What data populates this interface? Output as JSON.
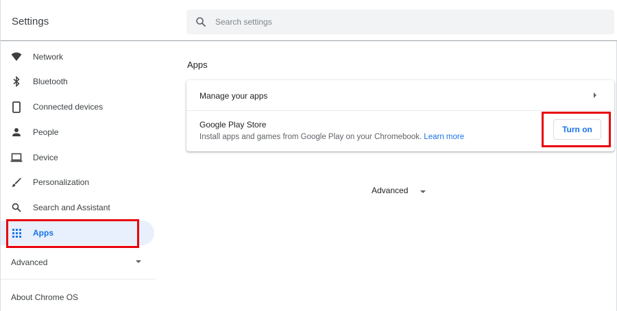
{
  "header": {
    "title": "Settings",
    "search_placeholder": "Search settings",
    "search_value": ""
  },
  "sidebar": {
    "items": [
      {
        "label": "Network",
        "icon": "wifi-icon"
      },
      {
        "label": "Bluetooth",
        "icon": "bluetooth-icon"
      },
      {
        "label": "Connected devices",
        "icon": "phone-icon"
      },
      {
        "label": "People",
        "icon": "person-icon"
      },
      {
        "label": "Device",
        "icon": "laptop-icon"
      },
      {
        "label": "Personalization",
        "icon": "brush-icon"
      },
      {
        "label": "Search and Assistant",
        "icon": "search-icon"
      },
      {
        "label": "Apps",
        "icon": "apps-grid-icon",
        "selected": true
      }
    ],
    "advanced_label": "Advanced",
    "about_label": "About Chrome OS"
  },
  "main": {
    "section_title": "Apps",
    "manage_apps_label": "Manage your apps",
    "play_store_title": "Google Play Store",
    "play_store_desc": "Install apps and games from Google Play on your Chromebook.",
    "learn_more": "Learn more",
    "turn_on_label": "Turn on",
    "advanced_label": "Advanced"
  },
  "colors": {
    "accent": "#1a73e8",
    "selected_bg": "#e8f0fe",
    "highlight": "#e8000b"
  }
}
